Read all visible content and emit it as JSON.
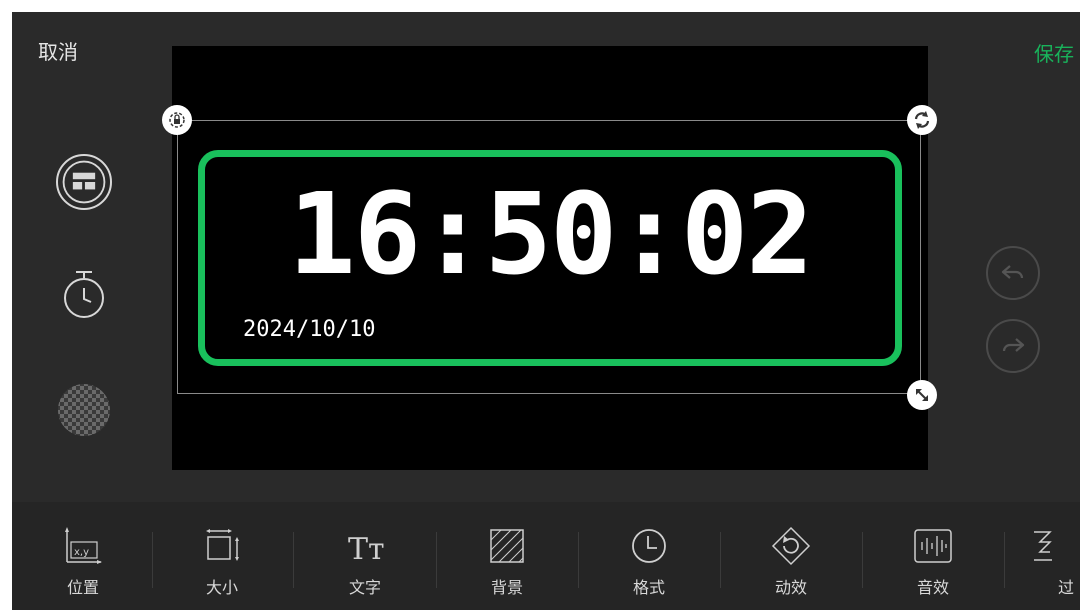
{
  "header": {
    "cancel_label": "取消",
    "save_label": "保存"
  },
  "clock": {
    "time": "16:50:02",
    "date": "2024/10/10",
    "frame_color": "#19c05c"
  },
  "handles": [
    "lock-icon",
    "rotate-icon",
    "resize-icon"
  ],
  "left_tools": [
    "layout-icon",
    "timer-icon",
    "transparency-icon"
  ],
  "right_tools": [
    "undo-icon",
    "redo-icon"
  ],
  "toolbar": {
    "items": [
      {
        "label": "位置",
        "icon": "position-icon",
        "icon_text": "x,y"
      },
      {
        "label": "大小",
        "icon": "size-icon"
      },
      {
        "label": "文字",
        "icon": "text-icon",
        "icon_text": "Tт"
      },
      {
        "label": "背景",
        "icon": "background-icon"
      },
      {
        "label": "格式",
        "icon": "clock-format-icon"
      },
      {
        "label": "动效",
        "icon": "animation-icon"
      },
      {
        "label": "音效",
        "icon": "sound-icon"
      },
      {
        "label": "过",
        "icon": "transition-icon"
      }
    ]
  },
  "colors": {
    "accent": "#19b25b",
    "background": "#2a2a2a",
    "canvas": "#000000"
  }
}
